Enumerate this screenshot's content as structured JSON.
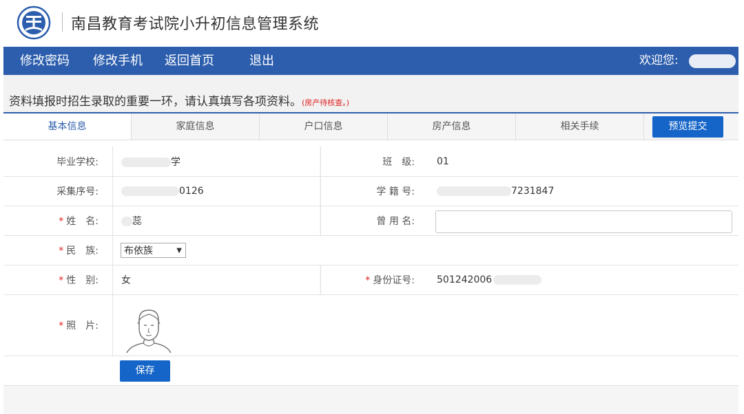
{
  "header": {
    "title": "南昌教育考试院小升初信息管理系统",
    "logo_icon": "school-emblem-icon"
  },
  "nav": {
    "items": [
      {
        "label": "修改密码"
      },
      {
        "label": "修改手机"
      },
      {
        "label": "返回首页"
      },
      {
        "label": "退出"
      }
    ],
    "welcome": "欢迎您:"
  },
  "notice": {
    "text": "资料填报时招生录取的重要一环，请认真填写各项资料。",
    "red_note": "(房产待核查。)"
  },
  "tabs": [
    {
      "label": "基本信息",
      "active": true
    },
    {
      "label": "家庭信息"
    },
    {
      "label": "户口信息"
    },
    {
      "label": "房产信息"
    },
    {
      "label": "相关手续"
    }
  ],
  "preview_button": "预览提交",
  "form": {
    "required_mark": "*",
    "school": {
      "label": "毕业学校:",
      "value": "学"
    },
    "class": {
      "label": "班　级:",
      "value": "01"
    },
    "collect_no": {
      "label": "采集序号:",
      "value": "0126"
    },
    "student_no": {
      "label": "学 籍 号:",
      "value": "7231847"
    },
    "name": {
      "label": "姓　名:",
      "value": "蕊"
    },
    "former_name": {
      "label": "曾 用 名:",
      "value": ""
    },
    "ethnicity": {
      "label": "民　族:",
      "value": "布依族"
    },
    "gender": {
      "label": "性　别:",
      "value": "女"
    },
    "id_no": {
      "label": "身份证号:",
      "value": "501242006"
    },
    "photo": {
      "label": "照　片:"
    },
    "save_button": "保存"
  },
  "colors": {
    "nav_bg": "#2c5ead",
    "button_bg": "#1565c8",
    "required": "#e02020"
  }
}
